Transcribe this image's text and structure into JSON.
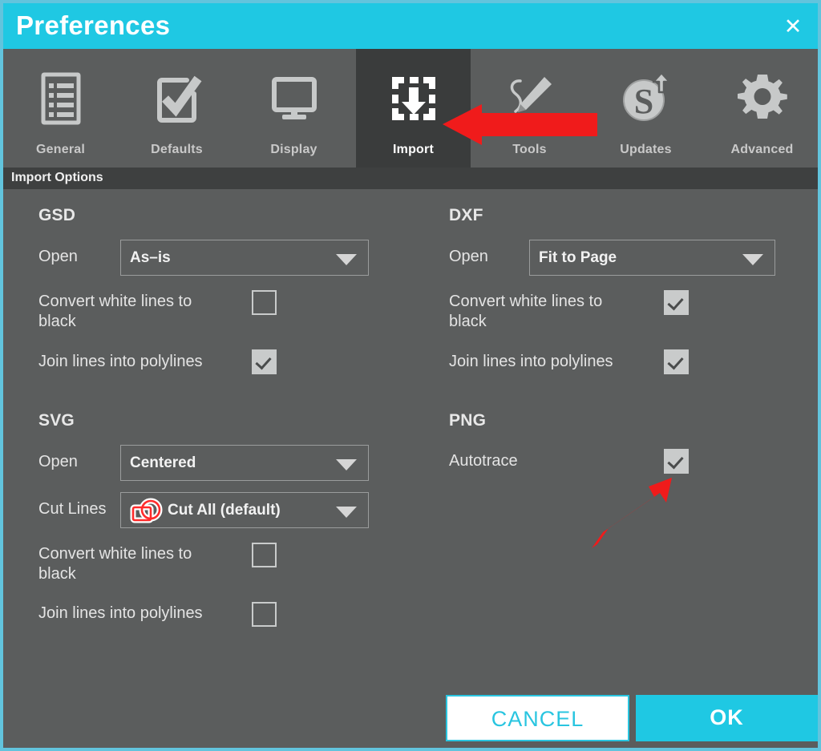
{
  "window": {
    "title": "Preferences",
    "close_label": "✕",
    "border_color": "#62c4dd",
    "titlebar_color": "#1fc8e3",
    "panel_color": "#5b5d5d"
  },
  "tabs": [
    {
      "label": "General",
      "icon": "list-document-icon",
      "active": false
    },
    {
      "label": "Defaults",
      "icon": "checkbox-check-icon",
      "active": false
    },
    {
      "label": "Display",
      "icon": "monitor-icon",
      "active": false
    },
    {
      "label": "Import",
      "icon": "import-arrow-icon",
      "active": true
    },
    {
      "label": "Tools",
      "icon": "pencil-draw-icon",
      "active": false
    },
    {
      "label": "Updates",
      "icon": "s-upload-icon",
      "active": false
    },
    {
      "label": "Advanced",
      "icon": "gear-icon",
      "active": false
    }
  ],
  "section": {
    "header": "Import Options"
  },
  "groups": {
    "gsd": {
      "title": "GSD",
      "open_label": "Open",
      "open_value": "As–is",
      "convert_label": "Convert white lines to\nblack",
      "convert_checked": false,
      "join_label": "Join lines into polylines",
      "join_checked": true
    },
    "dxf": {
      "title": "DXF",
      "open_label": "Open",
      "open_value": "Fit to Page",
      "convert_label": "Convert white lines to\nblack",
      "convert_checked": true,
      "join_label": "Join lines into polylines",
      "join_checked": true
    },
    "svg": {
      "title": "SVG",
      "open_label": "Open",
      "open_value": "Centered",
      "cutlines_label": "Cut Lines",
      "cutlines_value": "Cut All (default)",
      "cutlines_icon": "cut-all-shapes-icon",
      "cutlines_icon_color": "#ff2b2b",
      "convert_label": "Convert white lines to\nblack",
      "convert_checked": false,
      "join_label": "Join lines into polylines",
      "join_checked": false
    },
    "png": {
      "title": "PNG",
      "autotrace_label": "Autotrace",
      "autotrace_checked": true
    }
  },
  "footer": {
    "cancel_label": "CANCEL",
    "ok_label": "OK"
  },
  "annotations": {
    "arrow_color": "#f01b1b",
    "arrow_import_target": "Import",
    "arrow_autotrace_target": "Autotrace"
  }
}
